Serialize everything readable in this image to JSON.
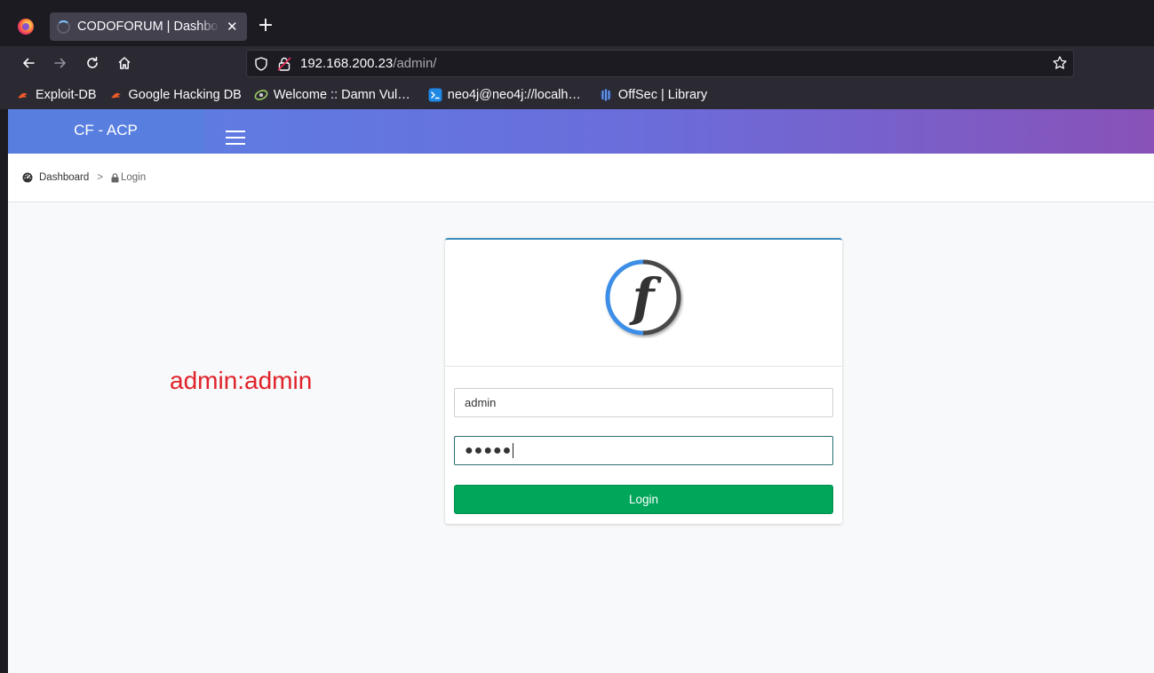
{
  "browser": {
    "tab_title": "CODOFORUM | Dashboard",
    "tab_close": "✕",
    "new_tab": "+",
    "url_host": "192.168.200.23",
    "url_path": "/admin/",
    "bookmarks": [
      {
        "label": "Exploit-DB",
        "icon": "kali-dragon-icon"
      },
      {
        "label": "Google Hacking DB",
        "icon": "kali-dragon-icon"
      },
      {
        "label": "Welcome :: Damn Vul…",
        "icon": "dvwa-icon"
      },
      {
        "label": "neo4j@neo4j://localh…",
        "icon": "terminal-icon"
      },
      {
        "label": "OffSec | Library",
        "icon": "offsec-icon"
      }
    ]
  },
  "app": {
    "brand": "CF - ACP",
    "breadcrumb": {
      "home": "Dashboard",
      "separator": ">",
      "current": "Login"
    },
    "annotation": "admin:admin",
    "login": {
      "username_value": "admin",
      "password_mask": "●●●●●",
      "button_label": "Login"
    }
  },
  "colors": {
    "header_start": "#5a82e6",
    "header_end": "#8852b8",
    "box_top_border": "#3c8dbc",
    "login_button": "#00a65a",
    "annotation": "#e0222a"
  }
}
